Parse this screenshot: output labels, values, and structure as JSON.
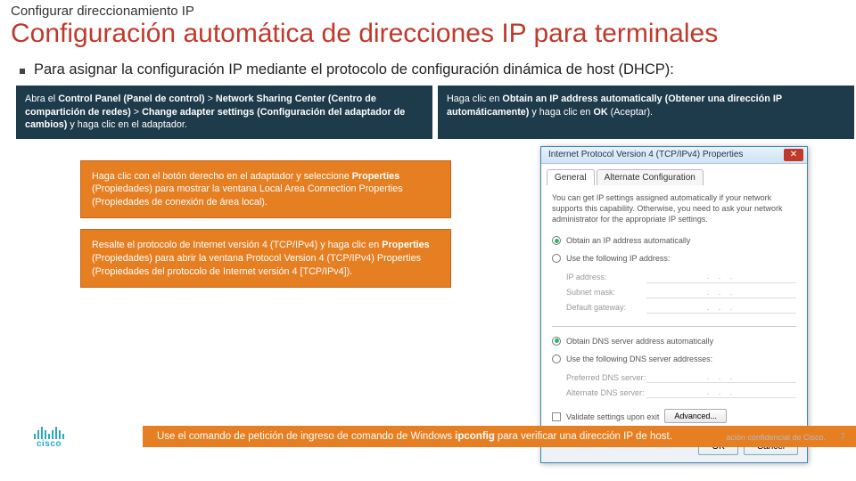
{
  "section": "Configurar direccionamiento IP",
  "title": "Configuración automática de direcciones IP para terminales",
  "bullet": "Para asignar la configuración IP mediante el protocolo de configuración dinámica de host (DHCP):",
  "dark_left": {
    "pre1": "Abra el ",
    "b1": "Control Panel (Panel de control)",
    "mid1": " > ",
    "b2": "Network Sharing Center (Centro de compartición de redes)",
    "mid2": " > ",
    "b3": "Change adapter settings (Configuración del adaptador de cambios)",
    "post": " y haga clic en el adaptador."
  },
  "dark_right": {
    "pre1": "Haga clic en ",
    "b1": "Obtain an IP address automatically (Obtener una dirección IP automáticamente)",
    "mid": " y haga clic en ",
    "b2": "OK",
    "post": " (Aceptar)."
  },
  "orange1": {
    "pre": "Haga clic con el botón derecho en el adaptador y seleccione ",
    "b1": "Properties",
    "post": " (Propiedades) para mostrar la ventana Local Area Connection Properties (Propiedades de conexión de área local)."
  },
  "orange2": {
    "pre": "Resalte el protocolo de Internet versión 4 (TCP/IPv4) y haga clic en ",
    "b1": "Properties",
    "post": " (Propiedades) para abrir la ventana Protocol Version 4 (TCP/IPv4) Properties (Propiedades del protocolo de Internet versión 4 [TCP/IPv4])."
  },
  "dialog": {
    "title": "Internet Protocol Version 4 (TCP/IPv4) Properties",
    "tab1": "General",
    "tab2": "Alternate Configuration",
    "desc": "You can get IP settings assigned automatically if your network supports this capability. Otherwise, you need to ask your network administrator for the appropriate IP settings.",
    "r1": "Obtain an IP address automatically",
    "r2": "Use the following IP address:",
    "f1": "IP address:",
    "f2": "Subnet mask:",
    "f3": "Default gateway:",
    "r3": "Obtain DNS server address automatically",
    "r4": "Use the following DNS server addresses:",
    "f4": "Preferred DNS server:",
    "f5": "Alternate DNS server:",
    "chk": "Validate settings upon exit",
    "adv": "Advanced...",
    "ok": "OK",
    "cancel": "Cancel"
  },
  "footer": {
    "pre": "Use el comando de petición de ingreso de comando de Windows ",
    "b": "ipconfig",
    "post": " para verificar una dirección IP de host."
  },
  "logo": "cisco",
  "confidential": "ación confidencial de Cisco.",
  "page": "7"
}
